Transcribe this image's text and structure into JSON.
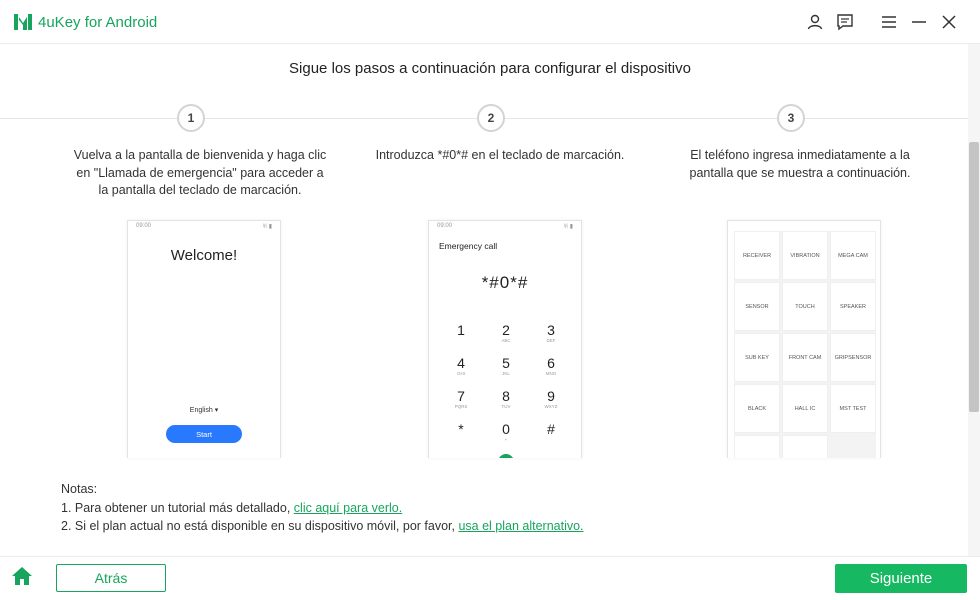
{
  "app": {
    "title": "4uKey for Android",
    "brand_color": "#17a55d",
    "title_icons": [
      "user-icon",
      "feedback-icon",
      "menu-icon",
      "minimize-icon",
      "close-icon"
    ]
  },
  "main": {
    "title": "Sigue los pasos a continuación para configurar el dispositivo",
    "steps": [
      {
        "number": "1",
        "description": "Vuelva a la pantalla de bienvenida y haga clic en \"Llamada de emergencia\" para acceder a la pantalla del teclado de marcación."
      },
      {
        "number": "2",
        "description": "Introduzca *#0*# en el teclado de marcación."
      },
      {
        "number": "3",
        "description": "El teléfono ingresa inmediatamente a la pantalla que se muestra a continuación."
      }
    ]
  },
  "phones": {
    "status_time": "09:00",
    "status_icons": "⁸⁄ₗ ▮",
    "welcome": {
      "heading": "Welcome!",
      "language": "English",
      "start_label": "Start"
    },
    "dialer": {
      "title": "Emergency call",
      "dialed": "*#0*#",
      "keys": [
        {
          "num": "1",
          "sub": ""
        },
        {
          "num": "2",
          "sub": "ABC"
        },
        {
          "num": "3",
          "sub": "DEF"
        },
        {
          "num": "4",
          "sub": "GHI"
        },
        {
          "num": "5",
          "sub": "JKL"
        },
        {
          "num": "6",
          "sub": "MNO"
        },
        {
          "num": "7",
          "sub": "PQRS"
        },
        {
          "num": "8",
          "sub": "TUV"
        },
        {
          "num": "9",
          "sub": "WXYZ"
        },
        {
          "num": "*",
          "sub": ""
        },
        {
          "num": "0",
          "sub": "+"
        },
        {
          "num": "#",
          "sub": ""
        }
      ]
    },
    "test_menu": {
      "cells": [
        "RECEIVER",
        "VIBRATION",
        "MEGA CAM",
        "SENSOR",
        "TOUCH",
        "SPEAKER",
        "SUB KEY",
        "FRONT CAM",
        "GRIPSENSOR",
        "BLACK",
        "HALL IC",
        "MST TEST",
        "",
        ""
      ]
    }
  },
  "notes": {
    "heading": "Notas:",
    "item1_prefix": "1. Para obtener un tutorial más detallado, ",
    "item1_link": "clic aquí para verlo.",
    "item2_prefix": "2. Si el plan actual no está disponible en su dispositivo móvil, por favor, ",
    "item2_link": "usa el plan alternativo."
  },
  "footer": {
    "back_label": "Atrás",
    "next_label": "Siguiente"
  }
}
